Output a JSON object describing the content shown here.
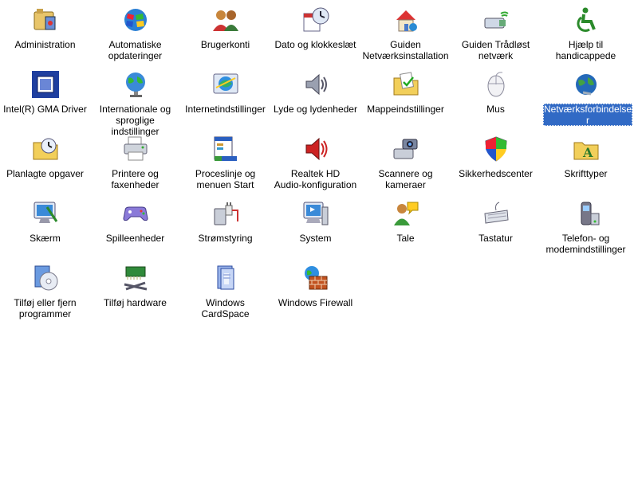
{
  "window": {
    "background": "#ffffff",
    "selection_color": "#316ac5"
  },
  "items": [
    {
      "label": "Administration",
      "icon": "administration-icon"
    },
    {
      "label": "Automatiske\nopdateringer",
      "icon": "automatic-updates-icon"
    },
    {
      "label": "Brugerkonti",
      "icon": "user-accounts-icon"
    },
    {
      "label": "Dato og klokkeslæt",
      "icon": "date-time-icon"
    },
    {
      "label": "Guiden\nNetværksinstallation",
      "icon": "network-setup-wizard-icon"
    },
    {
      "label": "Guiden Trådløst\nnetværk",
      "icon": "wireless-network-wizard-icon"
    },
    {
      "label": "Hjælp til\nhandicappede",
      "icon": "accessibility-icon"
    },
    {
      "label": "Intel(R) GMA Driver",
      "icon": "intel-gma-driver-icon"
    },
    {
      "label": "Internationale og\nsproglige indstillinger",
      "icon": "regional-language-icon"
    },
    {
      "label": "Internetindstillinger",
      "icon": "internet-options-icon"
    },
    {
      "label": "Lyde og lydenheder",
      "icon": "sounds-audio-icon"
    },
    {
      "label": "Mappeindstillinger",
      "icon": "folder-options-icon"
    },
    {
      "label": "Mus",
      "icon": "mouse-icon"
    },
    {
      "label": "Netværksforbindelse\nr",
      "icon": "network-connections-icon",
      "selected": true
    },
    {
      "label": "Planlagte opgaver",
      "icon": "scheduled-tasks-icon"
    },
    {
      "label": "Printere og\nfaxenheder",
      "icon": "printers-faxes-icon"
    },
    {
      "label": "Proceslinje og\nmenuen Start",
      "icon": "taskbar-start-menu-icon"
    },
    {
      "label": "Realtek HD\nAudio-konfiguration",
      "icon": "realtek-audio-icon"
    },
    {
      "label": "Scannere og\nkameraer",
      "icon": "scanners-cameras-icon"
    },
    {
      "label": "Sikkerhedscenter",
      "icon": "security-center-icon"
    },
    {
      "label": "Skrifttyper",
      "icon": "fonts-folder-icon"
    },
    {
      "label": "Skærm",
      "icon": "display-icon"
    },
    {
      "label": "Spilleenheder",
      "icon": "game-controllers-icon"
    },
    {
      "label": "Strømstyring",
      "icon": "power-options-icon"
    },
    {
      "label": "System",
      "icon": "system-icon"
    },
    {
      "label": "Tale",
      "icon": "speech-icon"
    },
    {
      "label": "Tastatur",
      "icon": "keyboard-icon"
    },
    {
      "label": "Telefon- og\nmodemindstillinger",
      "icon": "phone-modem-icon"
    },
    {
      "label": "Tilføj eller fjern\nprogrammer",
      "icon": "add-remove-programs-icon"
    },
    {
      "label": "Tilføj hardware",
      "icon": "add-hardware-icon"
    },
    {
      "label": "Windows CardSpace",
      "icon": "cardspace-icon"
    },
    {
      "label": "Windows Firewall",
      "icon": "firewall-icon"
    }
  ]
}
